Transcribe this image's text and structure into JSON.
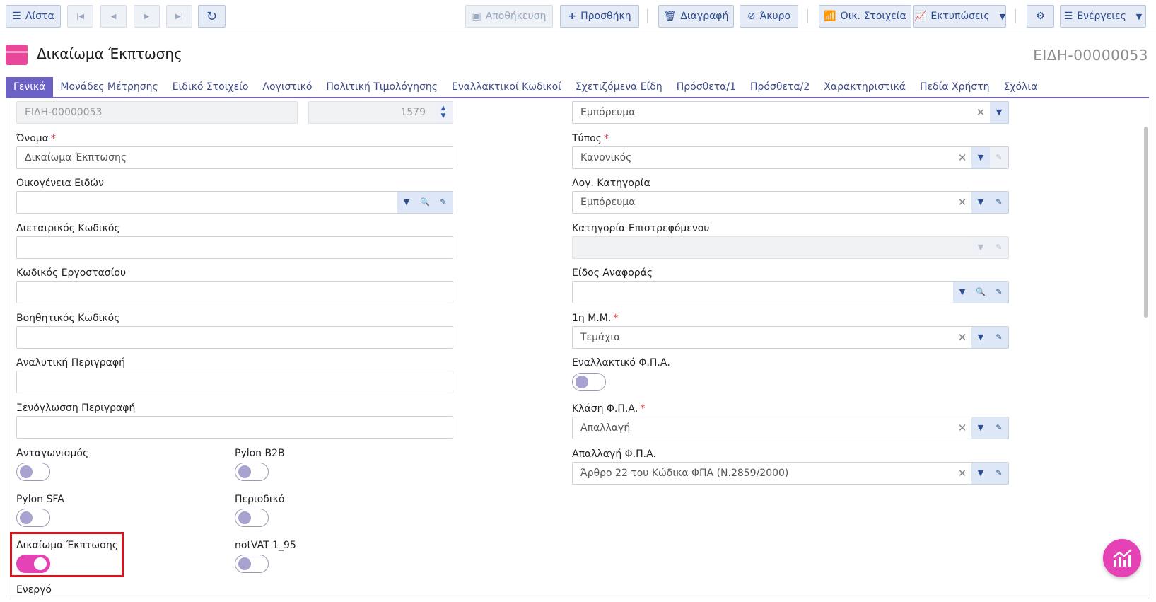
{
  "toolbar": {
    "list_label": "Λίστα",
    "save_label": "Αποθήκευση",
    "add_label": "Προσθήκη",
    "delete_label": "Διαγραφή",
    "cancel_label": "Άκυρο",
    "financial_label": "Οικ. Στοιχεία",
    "prints_label": "Εκτυπώσεις",
    "actions_label": "Ενέργειες"
  },
  "header": {
    "title": "Δικαίωμα Έκπτωσης",
    "record_code": "ΕΙΔΗ-00000053"
  },
  "tabs": [
    {
      "label": "Γενικά"
    },
    {
      "label": "Μονάδες Μέτρησης"
    },
    {
      "label": "Ειδικό Στοιχείο"
    },
    {
      "label": "Λογιστικό"
    },
    {
      "label": "Πολιτική Τιμολόγησης"
    },
    {
      "label": "Εναλλακτικοί Κωδικοί"
    },
    {
      "label": "Σχετιζόμενα Είδη"
    },
    {
      "label": "Πρόσθετα/1"
    },
    {
      "label": "Πρόσθετα/2"
    },
    {
      "label": "Χαρακτηριστικά"
    },
    {
      "label": "Πεδία Χρήστη"
    },
    {
      "label": "Σχόλια"
    }
  ],
  "form": {
    "code_value": "ΕΙΔΗ-00000053",
    "number_value": "1579",
    "top_right_value": "Εμπόρευμα",
    "name_label": "Όνομα",
    "name_value": "Δικαίωμα Έκπτωσης",
    "family_label": "Οικογένεια Ειδών",
    "family_value": "",
    "intl_code_label": "Διεταιρικός Κωδικός",
    "intl_code_value": "",
    "factory_code_label": "Κωδικός Εργοστασίου",
    "factory_code_value": "",
    "aux_code_label": "Βοηθητικός Κωδικός",
    "aux_code_value": "",
    "detailed_desc_label": "Αναλυτική Περιγραφή",
    "detailed_desc_value": "",
    "foreign_desc_label": "Ξενόγλωσση Περιγραφή",
    "foreign_desc_value": "",
    "type_label": "Τύπος",
    "type_value": "Κανονικός",
    "acc_category_label": "Λογ. Κατηγορία",
    "acc_category_value": "Εμπόρευμα",
    "return_category_label": "Κατηγορία Επιστρεφόμενου",
    "return_category_value": "",
    "report_type_label": "Είδος Αναφοράς",
    "report_type_value": "",
    "first_unit_label": "1η Μ.Μ.",
    "first_unit_value": "Τεμάχια",
    "alt_vat_label": "Εναλλακτικό Φ.Π.Α.",
    "vat_class_label": "Κλάση Φ.Π.Α.",
    "vat_class_value": "Απαλλαγή",
    "vat_exemption_label": "Απαλλαγή Φ.Π.Α.",
    "vat_exemption_value": "Άρθρο 22 του Κώδικα ΦΠΑ (Ν.2859/2000)",
    "competition_label": "Ανταγωνισμός",
    "pylon_b2b_label": "Pylon B2B",
    "pylon_sfa_label": "Pylon SFA",
    "periodic_label": "Περιοδικό",
    "discount_right_label": "Δικαίωμα Έκπτωσης",
    "notvat_label": "notVAT 1_95",
    "active_label": "Ενεργό"
  },
  "toggles": {
    "alt_vat": false,
    "competition": false,
    "pylon_b2b": false,
    "pylon_sfa": false,
    "periodic": false,
    "discount_right": true,
    "notvat": false
  },
  "colors": {
    "accent": "#6c62c5",
    "toggle_on": "#e542b5",
    "button_bg": "#e6ecf7",
    "button_text": "#2c4e93",
    "highlight": "#e0101d"
  }
}
